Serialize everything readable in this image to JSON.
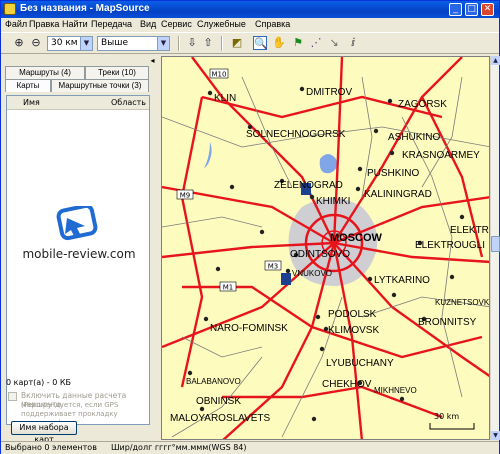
{
  "window": {
    "title": "Без названия - MapSource"
  },
  "menu": [
    "Файл",
    "Правка",
    "Найти",
    "Передача",
    "Вид",
    "Сервис",
    "Служебные",
    "Справка"
  ],
  "toolbar": {
    "zoom_value": "30 км",
    "detail_value": "Выше"
  },
  "tabs": {
    "routes": "Маршруты (4)",
    "tracks": "Треки (10)",
    "maps": "Карты",
    "waypoints": "Маршрутные точки (3)"
  },
  "list": {
    "col_name": "Имя",
    "col_region": "Область"
  },
  "watermark": "mobile-review.com",
  "summary": {
    "maps_count": "0 карт(а) - 0 КБ",
    "route_calc_label": "Включить данные расчета маршрута.",
    "route_calc_note": "(Рекомендуется, если GPS поддерживает прокладку маршрута)",
    "mapset_button": "Имя набора карт"
  },
  "status": {
    "selected": "Выбрано 0 элементов",
    "position": "Шир/долг гггг°мм.ммм(WGS 84)"
  },
  "map": {
    "scale": "30 km",
    "cities": [
      "KLIN",
      "DMITROV",
      "ZAGORSK",
      "SOLNECHNOGORSK",
      "ASHUKINO",
      "KRASNOARMEY",
      "PUSHKINO",
      "ZELENOGRAD",
      "KALININGRAD",
      "KHIMKI",
      "MOSCOW",
      "ODINTSOVO",
      "ELEKTROUGLI",
      "ELEKTR",
      "VNUKOVO",
      "LYTKARINO",
      "KUZNETSOVK",
      "NARO-FOMINSK",
      "PODOLSK",
      "KLIMOVSK",
      "BRONNITSY",
      "LYUBUCHANY",
      "CHEKHOV",
      "MIKHNEVO",
      "BALABANOVO",
      "OBNINSK",
      "MALOYAROSLAVETS"
    ],
    "road_shields": [
      "M10",
      "M9",
      "M1",
      "M3"
    ],
    "colors": {
      "background": "#fefbbf",
      "road": "#e8141c",
      "water": "#7fa6e8",
      "urban": "#cfcfd3"
    }
  }
}
